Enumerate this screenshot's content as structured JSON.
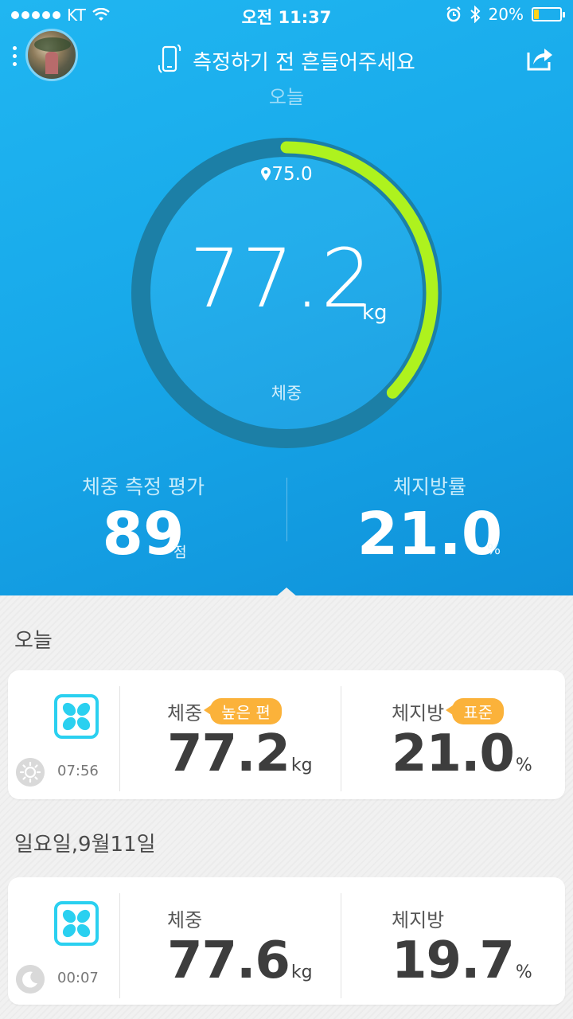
{
  "status_bar": {
    "carrier": "KT",
    "time": "오전 11:37",
    "battery": "20%",
    "battery_level": 0.2
  },
  "header": {
    "hint": "측정하기 전 흔들어주세요",
    "subtitle": "오늘"
  },
  "gauge": {
    "target": "75.0",
    "weight": "77.2",
    "unit": "kg",
    "label": "체중",
    "progress_fraction": 0.37,
    "track_color": "#1c7fa6",
    "progress_color": "#aef21e"
  },
  "stats": {
    "score_label": "체중 측정 평가",
    "score_value": "89",
    "score_unit": "점",
    "fat_label": "체지방률",
    "fat_value": "21.0",
    "fat_unit": "%"
  },
  "history": {
    "today_title": "오늘",
    "entries": [
      {
        "time": "07:56",
        "tod_icon": "sun-icon",
        "weight_label": "체중",
        "weight_badge": "높은 편",
        "weight_value": "77.2",
        "weight_unit": "kg",
        "fat_label": "체지방",
        "fat_badge": "표준",
        "fat_value": "21.0",
        "fat_unit": "%"
      },
      {
        "time": "00:07",
        "tod_icon": "moon-icon",
        "weight_label": "체중",
        "weight_value": "77.6",
        "weight_unit": "kg",
        "fat_label": "체지방",
        "fat_value": "19.7",
        "fat_unit": "%"
      }
    ],
    "date_title": "일요일,9월11일"
  },
  "colors": {
    "accent": "#1ab0ee",
    "badge": "#fbb23a",
    "logo": "#2ad0f0"
  }
}
